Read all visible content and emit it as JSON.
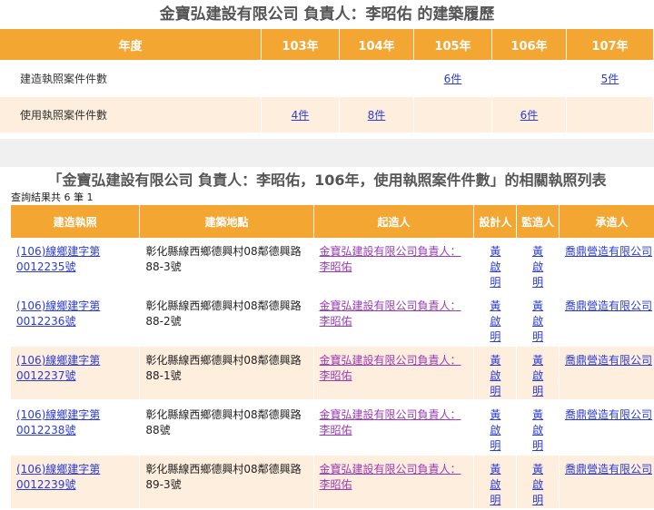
{
  "summary": {
    "title": "金寶弘建設有限公司 負責人：李昭佑 的建築履歷",
    "headers": [
      "年度",
      "103年",
      "104年",
      "105年",
      "106年",
      "107年"
    ],
    "rows": [
      {
        "label": "建造執照案件件數",
        "cells": [
          "",
          "",
          "6件",
          "",
          "5件"
        ]
      },
      {
        "label": "使用執照案件件數",
        "cells": [
          "4件",
          "8件",
          "",
          "6件",
          ""
        ]
      }
    ]
  },
  "list": {
    "title": "「金寶弘建設有限公司 負責人：李昭佑，106年，使用執照案件件數」的相關執照列表",
    "count_text": "查詢結果共 6 筆  1",
    "headers": [
      "建造執照",
      "建築地點",
      "起造人",
      "設計人",
      "監造人",
      "承造人"
    ],
    "rows": [
      {
        "permit": "(106)線鄉建字第0012235號",
        "address": "彰化縣線西鄉德興村08鄰德興路88-3號",
        "builder": "金寶弘建設有限公司負責人：李昭佑",
        "designer": "黃啟明",
        "supervisor": "黃啟明",
        "contractor": "喬鼎營造有限公司"
      },
      {
        "permit": "(106)線鄉建字第0012236號",
        "address": "彰化縣線西鄉德興村08鄰德興路88-2號",
        "builder": "金寶弘建設有限公司負責人：李昭佑",
        "designer": "黃啟明",
        "supervisor": "黃啟明",
        "contractor": "喬鼎營造有限公司"
      },
      {
        "permit": "(106)線鄉建字第0012237號",
        "address": "彰化縣線西鄉德興村08鄰德興路88-1號",
        "builder": "金寶弘建設有限公司負責人：李昭佑",
        "designer": "黃啟明",
        "supervisor": "黃啟明",
        "contractor": "喬鼎營造有限公司"
      },
      {
        "permit": "(106)線鄉建字第0012238號",
        "address": "彰化縣線西鄉德興村08鄰德興路88號",
        "builder": "金寶弘建設有限公司負責人：李昭佑",
        "designer": "黃啟明",
        "supervisor": "黃啟明",
        "contractor": "喬鼎營造有限公司"
      },
      {
        "permit": "(106)線鄉建字第0012239號",
        "address": "彰化縣線西鄉德興村08鄰德興路89-3號",
        "builder": "金寶弘建設有限公司負責人：李昭佑",
        "designer": "黃啟明",
        "supervisor": "黃啟明",
        "contractor": "喬鼎營造有限公司"
      }
    ]
  },
  "colors": {
    "header_bg": "#f4a632",
    "alt_row_bg": "#fdeedd",
    "link": "#2b3bd6",
    "visited_link": "#9b3bb5"
  }
}
